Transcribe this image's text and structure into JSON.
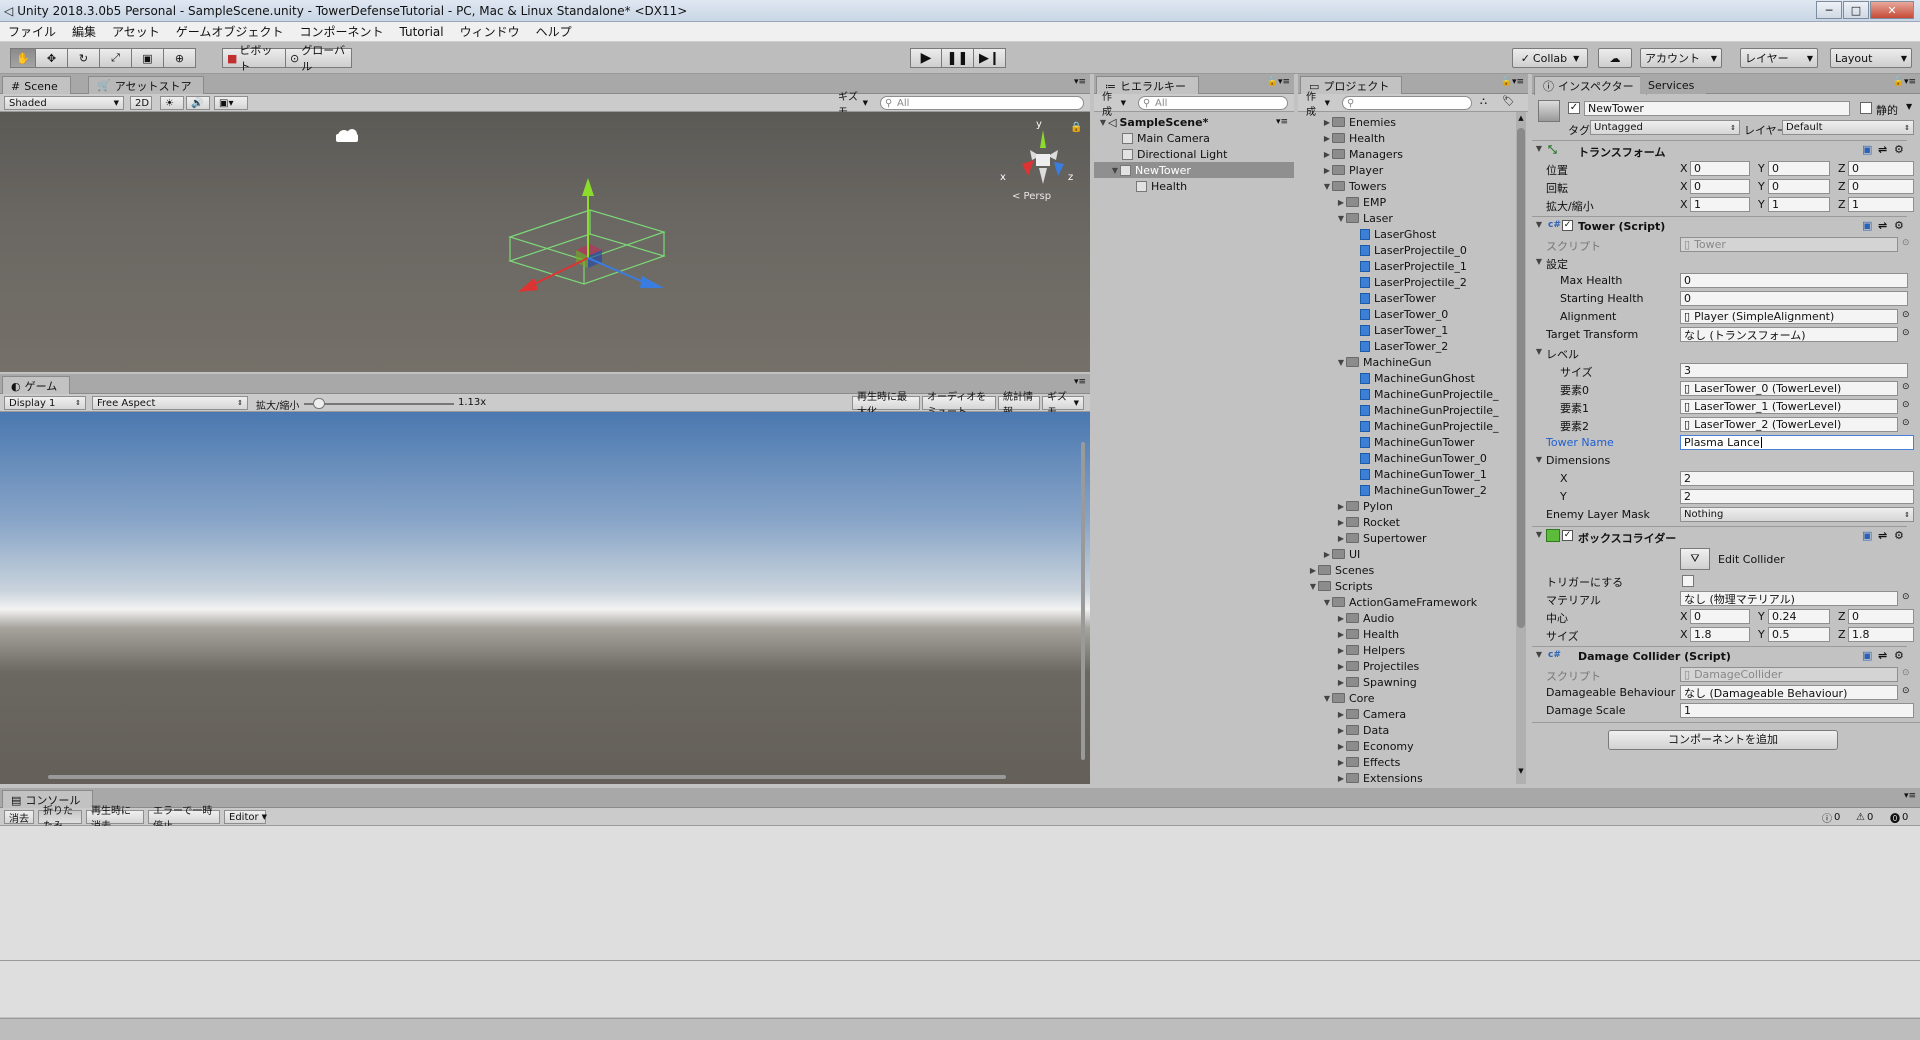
{
  "window": {
    "title": "Unity 2018.3.0b5 Personal - SampleScene.unity - TowerDefenseTutorial - PC, Mac & Linux Standalone* <DX11>",
    "minimize": "─",
    "maximize": "□",
    "close": "✕"
  },
  "menu": [
    "ファイル",
    "編集",
    "アセット",
    "ゲームオブジェクト",
    "コンポーネント",
    "Tutorial",
    "ウィンドウ",
    "ヘルプ"
  ],
  "toolbar": {
    "pivot": "ピボット",
    "global": "グローバル",
    "collab": "Collab",
    "account": "アカウント",
    "layers": "レイヤー",
    "layout": "Layout"
  },
  "scene": {
    "tab": "Scene",
    "tab2": "アセットストア",
    "shading": "Shaded",
    "mode2d": "2D",
    "gizmos": "ギズモ",
    "search": "All",
    "persp": "< Persp"
  },
  "game": {
    "tab": "ゲーム",
    "display": "Display 1",
    "aspect": "Free Aspect",
    "scale_label": "拡大/縮小",
    "scale_value": "1.13x",
    "scale_fraction": 0.1,
    "maximize": "再生時に最大化",
    "mute": "オーディオをミュート",
    "stats": "統計情報",
    "gizmos": "ギズモ"
  },
  "hierarchy": {
    "tab": "ヒエラルキー",
    "create": "作成",
    "search": "All",
    "items": [
      "SampleScene*",
      "Main Camera",
      "Directional Light",
      "NewTower",
      "Health"
    ]
  },
  "project": {
    "tab": "プロジェクト",
    "create": "作成",
    "items": [
      "Enemies",
      "Health",
      "Managers",
      "Player",
      "Towers",
      "EMP",
      "Laser",
      "LaserGhost",
      "LaserProjectile_0",
      "LaserProjectile_1",
      "LaserProjectile_2",
      "LaserTower",
      "LaserTower_0",
      "LaserTower_1",
      "LaserTower_2",
      "MachineGun",
      "MachineGunGhost",
      "MachineGunProjectile_",
      "MachineGunProjectile_",
      "MachineGunProjectile_",
      "MachineGunTower",
      "MachineGunTower_0",
      "MachineGunTower_1",
      "MachineGunTower_2",
      "Pylon",
      "Rocket",
      "Supertower",
      "UI",
      "Scenes",
      "Scripts",
      "ActionGameFramework",
      "Audio",
      "Health",
      "Helpers",
      "Projectiles",
      "Spawning",
      "Core",
      "Camera",
      "Data",
      "Economy",
      "Effects",
      "Extensions"
    ]
  },
  "inspector": {
    "tab": "インスペクター",
    "tab2": "Services",
    "name": "NewTower",
    "static": "静的",
    "tag_label": "タグ",
    "tag": "Untagged",
    "layer_label": "レイヤー",
    "layer": "Default",
    "transform": {
      "title": "トランスフォーム",
      "position": "位置",
      "rotation": "回転",
      "scale": "拡大/縮小",
      "pos": [
        "0",
        "0",
        "0"
      ],
      "rot": [
        "0",
        "0",
        "0"
      ],
      "scl": [
        "1",
        "1",
        "1"
      ]
    },
    "tower": {
      "title": "Tower (Script)",
      "script_label": "スクリプト",
      "script": "Tower",
      "settings": "設定",
      "max_health_label": "Max Health",
      "max_health": "0",
      "starting_health_label": "Starting Health",
      "starting_health": "0",
      "alignment_label": "Alignment",
      "alignment": "Player (SimpleAlignment)",
      "target_label": "Target Transform",
      "target": "なし (トランスフォーム)",
      "levels": "レベル",
      "size_label": "サイズ",
      "size": "3",
      "el0_label": "要素0",
      "el0": "LaserTower_0 (TowerLevel)",
      "el1_label": "要素1",
      "el1": "LaserTower_1 (TowerLevel)",
      "el2_label": "要素2",
      "el2": "LaserTower_2 (TowerLevel)",
      "name_label": "Tower Name",
      "name": "Plasma Lance",
      "dimensions": "Dimensions",
      "x_label": "X",
      "x": "2",
      "y_label": "Y",
      "y": "2",
      "mask_label": "Enemy Layer Mask",
      "mask": "Nothing"
    },
    "box": {
      "title": "ボックスコライダー",
      "edit": "Edit Collider",
      "trigger": "トリガーにする",
      "material_label": "マテリアル",
      "material": "なし (物理マテリアル)",
      "center": "中心",
      "center_v": [
        "0",
        "0.24",
        "0"
      ],
      "size": "サイズ",
      "size_v": [
        "1.8",
        "0.5",
        "1.8"
      ]
    },
    "damage": {
      "title": "Damage Collider (Script)",
      "script_label": "スクリプト",
      "script": "DamageCollider",
      "behaviour_label": "Damageable Behaviour",
      "behaviour": "なし (Damageable Behaviour)",
      "scale_label": "Damage Scale",
      "scale": "1"
    },
    "add_component": "コンポーネントを追加"
  },
  "console": {
    "tab": "コンソール",
    "clear": "消去",
    "collapse": "折りたたみ",
    "clear_on_play": "再生時に消去",
    "error_pause": "エラーで一時停止",
    "editor": "Editor",
    "logs": "0",
    "warnings": "0",
    "errors": "0"
  }
}
